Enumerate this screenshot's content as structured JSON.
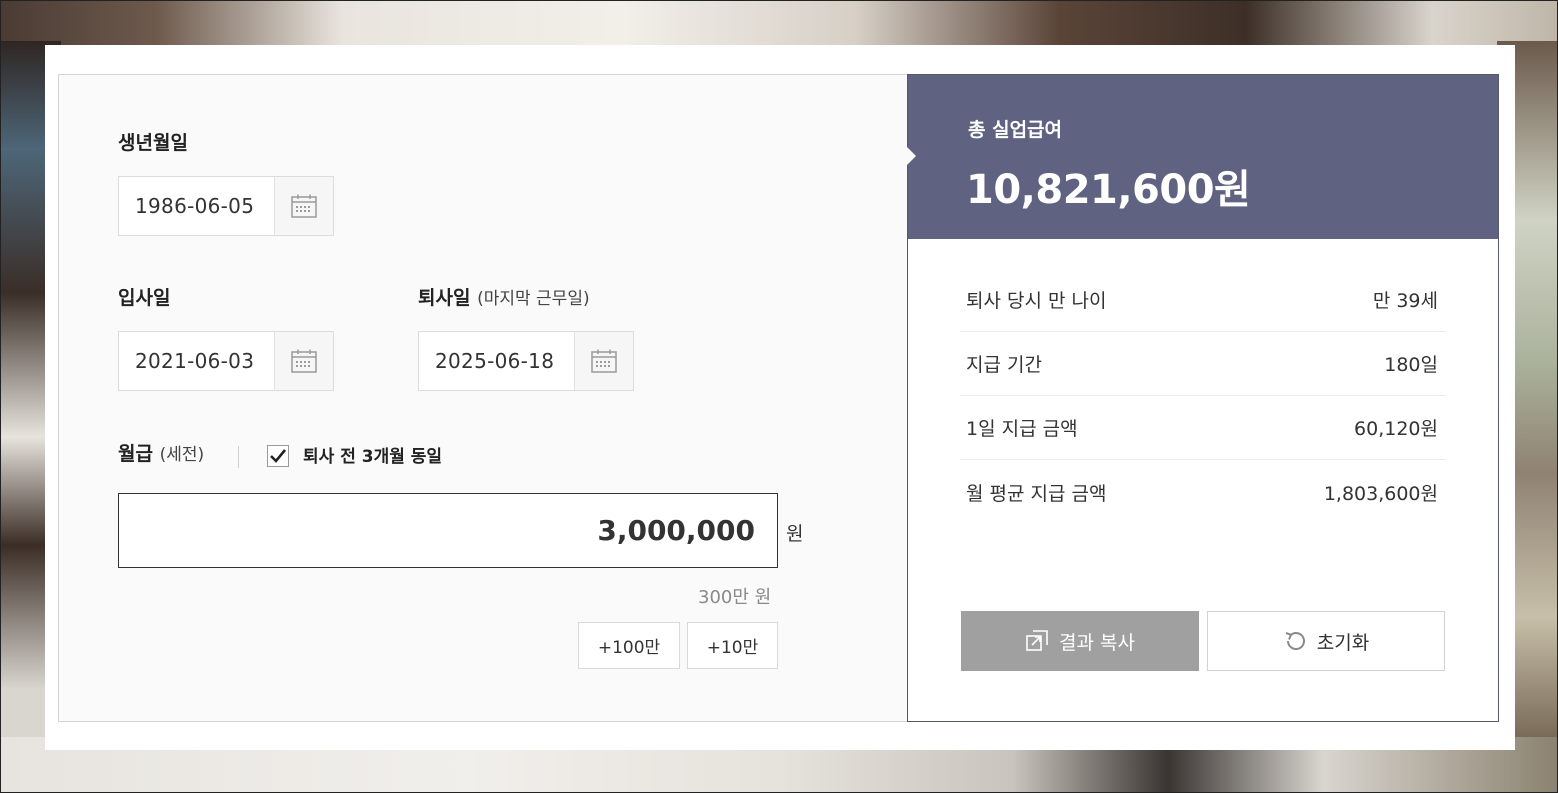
{
  "form": {
    "birth": {
      "label": "생년월일",
      "value": "1986-06-05"
    },
    "join": {
      "label": "입사일",
      "value": "2021-06-03"
    },
    "leave": {
      "label": "퇴사일",
      "label_sub": "(마지막 근무일)",
      "value": "2025-06-18"
    },
    "salary": {
      "label": "월급",
      "label_sub": "(세전)",
      "checkbox_label": "퇴사 전 3개월 동일",
      "checkbox_checked": true,
      "value": "3,000,000",
      "unit": "원",
      "hint": "300만 원",
      "quick_buttons": [
        "+100만",
        "+10만"
      ]
    }
  },
  "result": {
    "total_label": "총 실업급여",
    "total_value": "10,821,600원",
    "rows": [
      {
        "key": "퇴사 당시 만 나이",
        "value": "만 39세"
      },
      {
        "key": "지급 기간",
        "value": "180일"
      },
      {
        "key": "1일 지급 금액",
        "value": "60,120원"
      },
      {
        "key": "월 평균 지급 금액",
        "value": "1,803,600원"
      }
    ],
    "copy_button": "결과 복사",
    "reset_button": "초기화"
  },
  "colors": {
    "accent_panel": "#5f6281",
    "copy_button_bg": "#a0a0a0"
  }
}
